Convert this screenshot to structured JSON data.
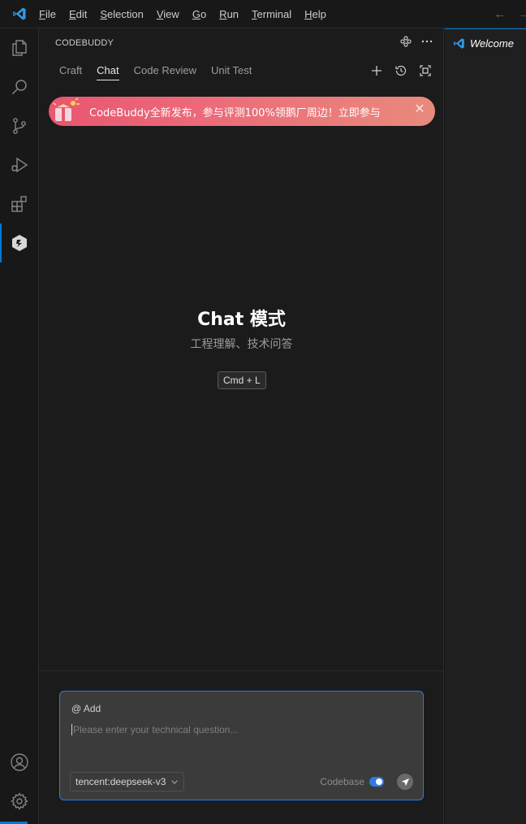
{
  "menu": {
    "items": [
      {
        "label": "File",
        "mnemonic": "F"
      },
      {
        "label": "Edit",
        "mnemonic": "E"
      },
      {
        "label": "Selection",
        "mnemonic": "S"
      },
      {
        "label": "View",
        "mnemonic": "V"
      },
      {
        "label": "Go",
        "mnemonic": "G"
      },
      {
        "label": "Run",
        "mnemonic": "R"
      },
      {
        "label": "Terminal",
        "mnemonic": "T"
      },
      {
        "label": "Help",
        "mnemonic": "H"
      }
    ]
  },
  "panel": {
    "title": "CODEBUDDY",
    "tabs": [
      "Craft",
      "Chat",
      "Code Review",
      "Unit Test"
    ],
    "active_tab": "Chat"
  },
  "banner": {
    "text": "CodeBuddy全新发布，参与评测100%领鹅厂周边！立即参与",
    "close_glyph": "✕"
  },
  "hero": {
    "title": "Chat 模式",
    "subtitle": "工程理解、技术问答",
    "shortcut": "Cmd + L"
  },
  "composer": {
    "add_label": "@ Add",
    "placeholder": "Please enter your technical question...",
    "value": "",
    "model": "tencent:deepseek-v3",
    "codebase_label": "Codebase",
    "codebase_enabled": true
  },
  "editor": {
    "tab_label": "Welcome"
  },
  "colors": {
    "accent": "#0078d4",
    "focus_border": "#2f7adf",
    "banner_start": "#e9566e",
    "banner_end": "#e98a7c"
  },
  "icons": {
    "activity": [
      "explorer-icon",
      "search-icon",
      "source-control-icon",
      "run-debug-icon",
      "extensions-icon",
      "codebuddy-icon",
      "account-icon",
      "settings-gear-icon"
    ]
  }
}
